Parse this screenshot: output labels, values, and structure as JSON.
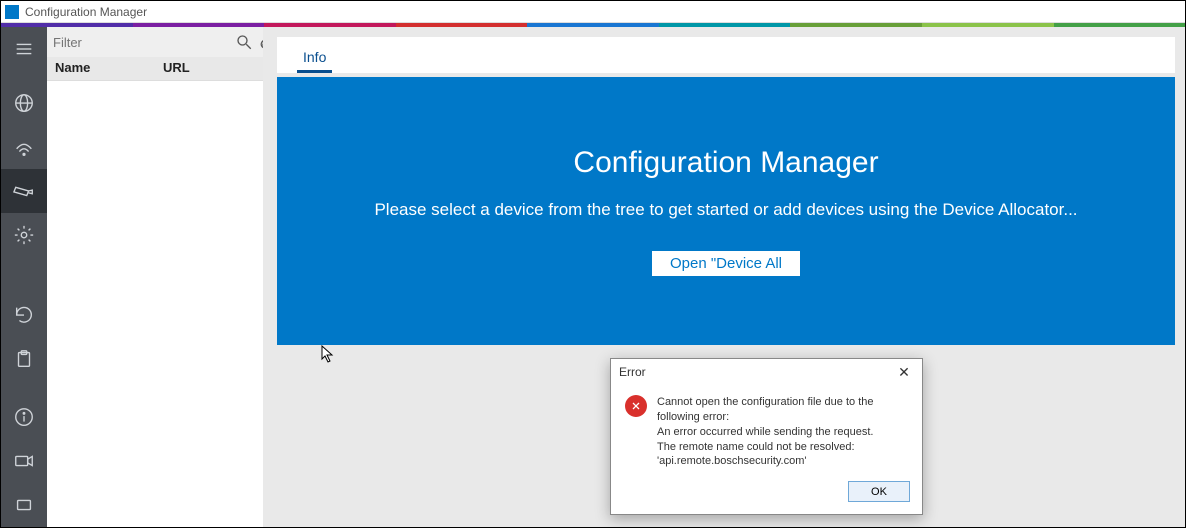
{
  "window": {
    "title": "Configuration Manager"
  },
  "accent_colors": [
    "#512da8",
    "#7b1fa2",
    "#c2185b",
    "#d32f2f",
    "#1976d2",
    "#0097a7",
    "#689f38",
    "#8bc34a",
    "#43a047"
  ],
  "rail": {
    "items": [
      {
        "name": "menu-icon"
      },
      {
        "name": "network-icon"
      },
      {
        "name": "wifi-icon"
      },
      {
        "name": "camera-icon",
        "active": true
      },
      {
        "name": "gear-icon"
      },
      {
        "name": "refresh-icon"
      },
      {
        "name": "clipboard-icon"
      }
    ],
    "bottom_items": [
      {
        "name": "info-icon"
      },
      {
        "name": "video-icon"
      },
      {
        "name": "device-icon"
      }
    ]
  },
  "tree": {
    "filter_placeholder": "Filter",
    "columns": [
      "Name",
      "URL"
    ]
  },
  "tabs": [
    {
      "label": "Info",
      "active": true
    }
  ],
  "welcome": {
    "title": "Configuration Manager",
    "subtitle": "Please select a device from the tree to get started or add devices using the Device Allocator...",
    "button_label": "Open  \"Device All"
  },
  "dialog": {
    "title": "Error",
    "lines": [
      "Cannot open the configuration file due to the following error:",
      "An error occurred while sending the request.",
      "The remote name could not be resolved:",
      "'api.remote.boschsecurity.com'"
    ],
    "ok_label": "OK"
  }
}
